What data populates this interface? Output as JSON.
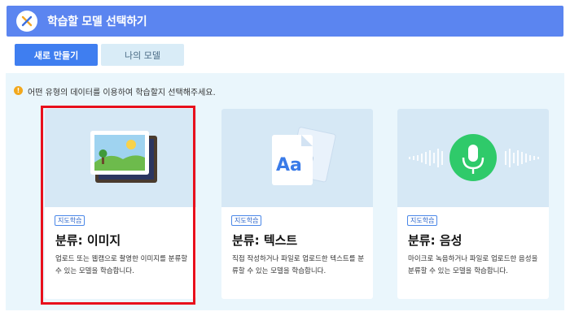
{
  "header": {
    "title": "학습할 모델 선택하기",
    "close_icon": "close-icon",
    "accent": "#5b85f0"
  },
  "tabs": [
    {
      "label": "새로 만들기",
      "active": true
    },
    {
      "label": "나의 모델",
      "active": false
    }
  ],
  "notice": {
    "icon": "info-icon",
    "icon_glyph": "!",
    "text": "어떤 유형의 데이터를 이용하여 학습할지 선택해주세요."
  },
  "cards": [
    {
      "badge": "지도학습",
      "title": "분류: 이미지",
      "desc": "업로드 또는 웹캠으로 촬영한 이미지를 분류할 수 있는 모델을 학습합니다.",
      "icon": "image-icon",
      "selected": true
    },
    {
      "badge": "지도학습",
      "title": "분류: 텍스트",
      "desc": "직접 작성하거나 파일로 업로드한 텍스트를 분류할 수 있는 모델을 학습합니다.",
      "icon": "text-document-icon",
      "icon_text": "Aa",
      "selected": false
    },
    {
      "badge": "지도학습",
      "title": "분류: 음성",
      "desc": "마이크로 녹음하거나 파일로 업로드한 음성을 분류할 수 있는 모델을 학습합니다.",
      "icon": "microphone-icon",
      "selected": false
    }
  ],
  "colors": {
    "selected_border": "#e8101c",
    "primary_button": "#3f7ef0",
    "mic_green": "#2fca6a"
  }
}
